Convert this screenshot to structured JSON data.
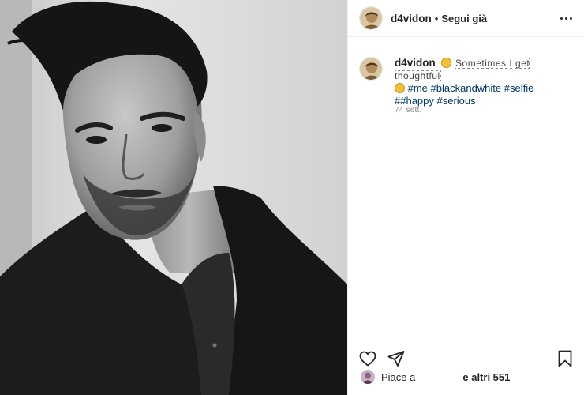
{
  "header": {
    "username": "d4vidon",
    "separator": "•",
    "follow_label": "Segui già"
  },
  "caption": {
    "username": "d4vidon",
    "obscured_text": "Sometimes I get thoughtful",
    "hashtags_line1": "#me #blackandwhite #selfie",
    "hashtags_line2": "##happy #serious",
    "time": "74 sett."
  },
  "likes": {
    "prefix": "Piace a",
    "suffix": "e altri 551"
  },
  "icons": {
    "more": "more-options-icon",
    "like": "heart-icon",
    "share": "paper-plane-icon",
    "save": "bookmark-icon"
  },
  "colors": {
    "text": "#262626",
    "hashtag": "#00376b",
    "muted": "#8e8e8e",
    "border": "#efefef"
  }
}
